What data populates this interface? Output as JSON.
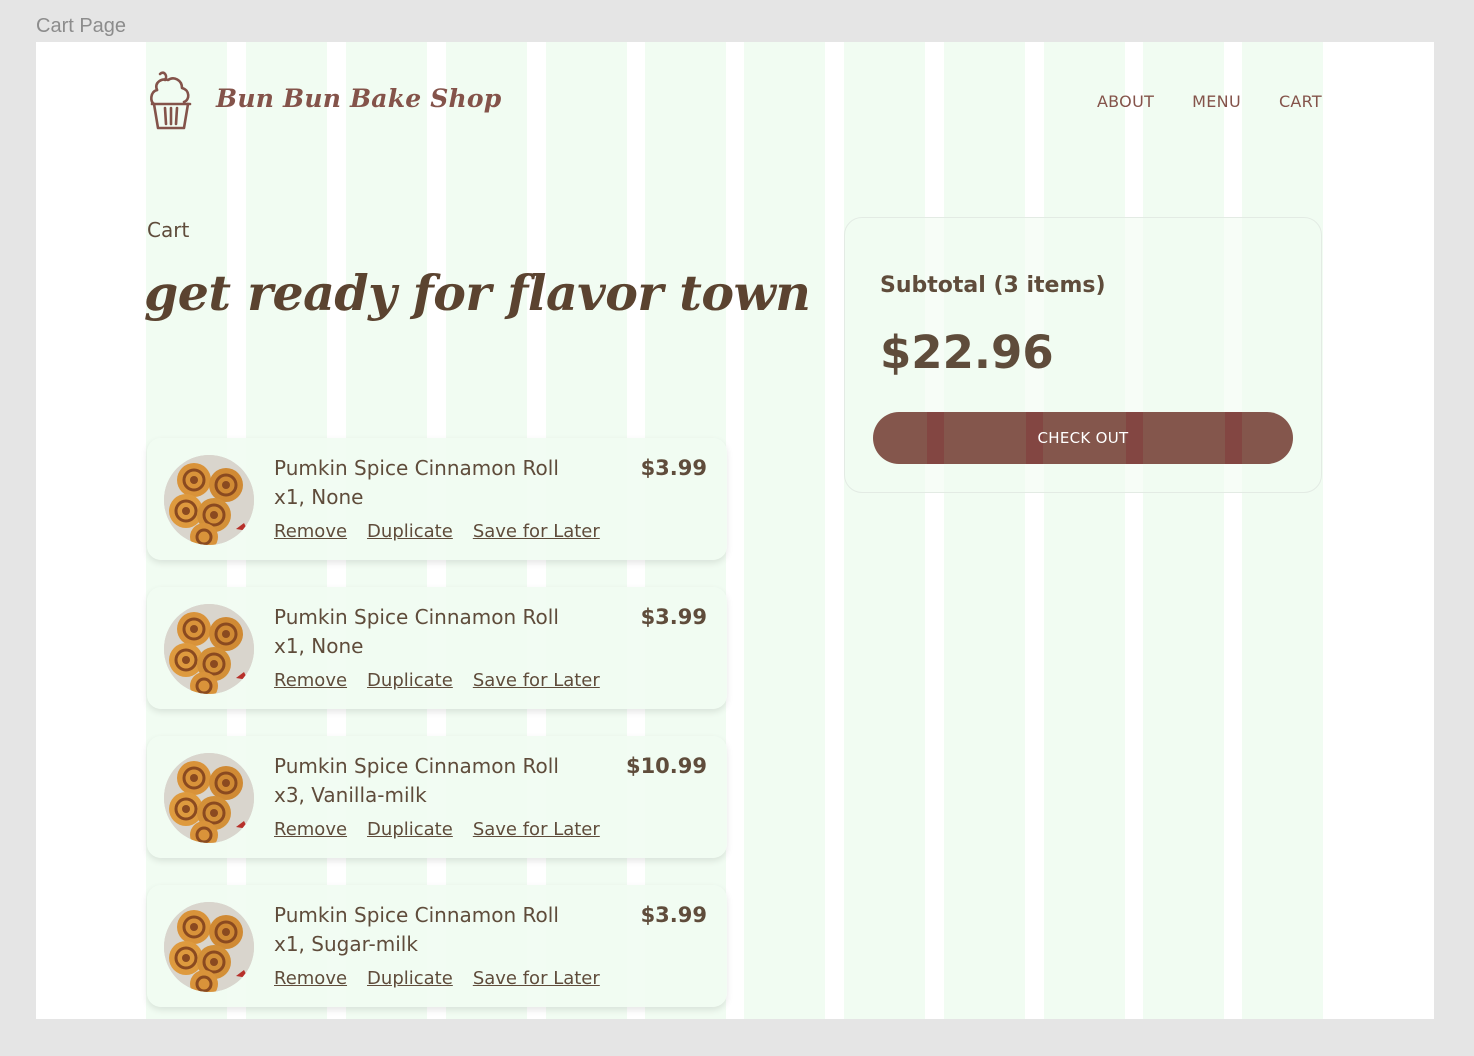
{
  "frame": {
    "label": "Cart Page"
  },
  "header": {
    "brand": "Bun Bun Bake Shop",
    "logo_icon": "cupcake-icon",
    "nav": [
      {
        "label": "ABOUT"
      },
      {
        "label": "MENU"
      },
      {
        "label": "CART"
      }
    ]
  },
  "page": {
    "breadcrumb": "Cart",
    "headline": "get ready for flavor town"
  },
  "cart": {
    "items": [
      {
        "name": "Pumkin Spice Cinnamon Roll",
        "options": "x1, None",
        "price": "$3.99",
        "remove": "Remove",
        "duplicate": "Duplicate",
        "save": "Save for Later"
      },
      {
        "name": "Pumkin Spice Cinnamon Roll",
        "options": "x1, None",
        "price": "$3.99",
        "remove": "Remove",
        "duplicate": "Duplicate",
        "save": "Save for Later"
      },
      {
        "name": "Pumkin Spice Cinnamon Roll",
        "options": "x3, Vanilla-milk",
        "price": "$10.99",
        "remove": "Remove",
        "duplicate": "Duplicate",
        "save": "Save for Later"
      },
      {
        "name": "Pumkin Spice Cinnamon Roll",
        "options": "x1, Sugar-milk",
        "price": "$3.99",
        "remove": "Remove",
        "duplicate": "Duplicate",
        "save": "Save for Later"
      }
    ]
  },
  "summary": {
    "subtotal_label": "Subtotal (3 items)",
    "subtotal_value": "$22.96",
    "checkout_label": "CHECK OUT"
  },
  "colors": {
    "brand": "#84534a",
    "text": "#5f4c3b",
    "button": "#84564c",
    "grid_overlay": "#f1fcf2",
    "canvas": "#e5e5e5"
  }
}
